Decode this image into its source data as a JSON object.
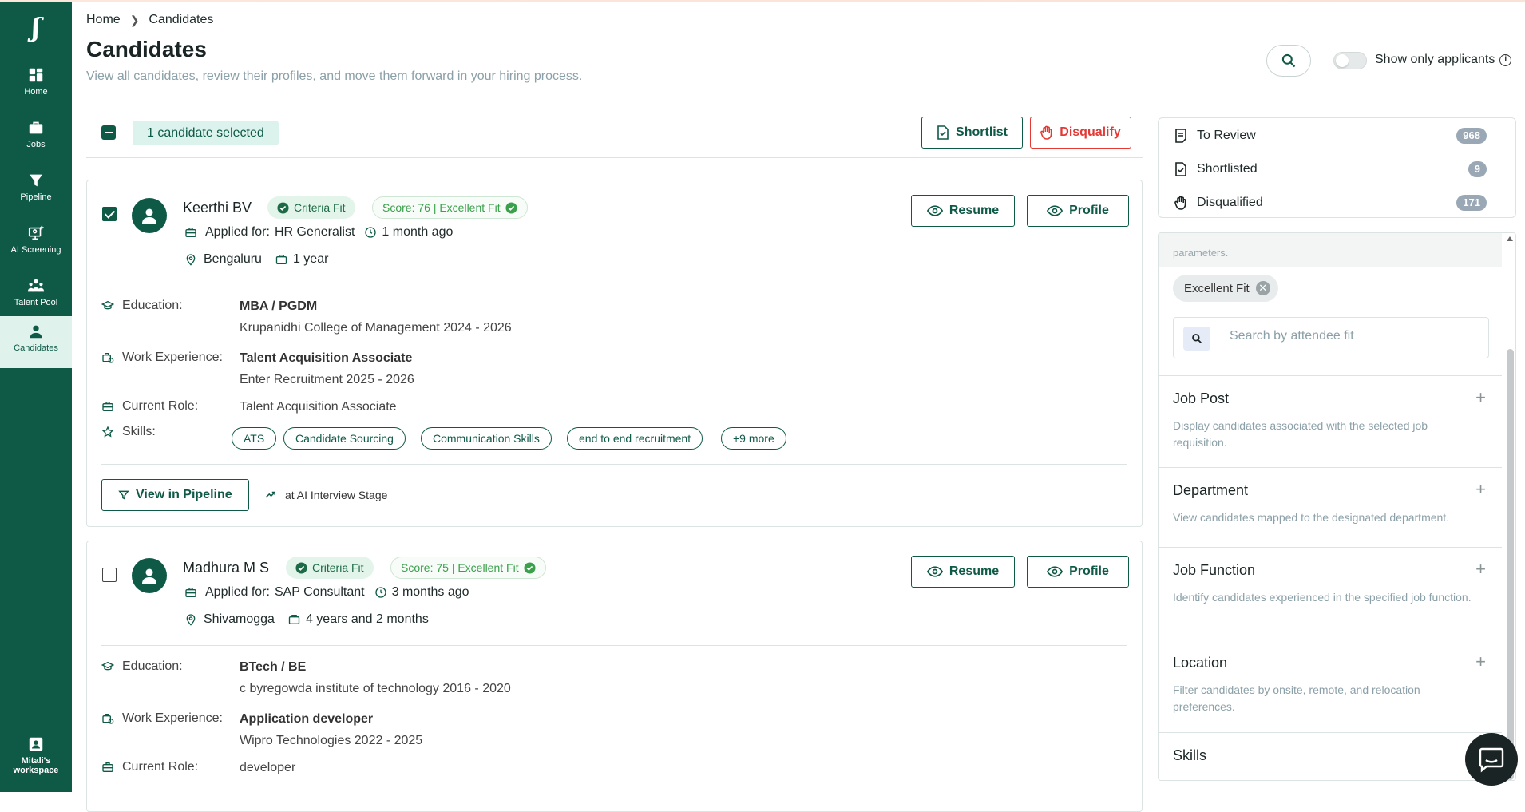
{
  "sidebar": {
    "logo": "ʃ",
    "items": [
      {
        "label": "Home"
      },
      {
        "label": "Jobs"
      },
      {
        "label": "Pipeline"
      },
      {
        "label": "AI Screening"
      },
      {
        "label": "Talent Pool"
      },
      {
        "label": "Candidates"
      }
    ],
    "workspace_line1": "Mitali's",
    "workspace_line2": "workspace"
  },
  "breadcrumb": {
    "home": "Home",
    "current": "Candidates"
  },
  "page": {
    "title": "Candidates",
    "subtitle": "View all candidates, review their profiles, and move them forward in your hiring process.",
    "show_only_label": "Show only applicants",
    "show_only_enabled": false
  },
  "selection": {
    "label": "1 candidate selected",
    "shortlist": "Shortlist",
    "disqualify": "Disqualify"
  },
  "labels": {
    "applied_for": "Applied for:",
    "education": "Education:",
    "work_experience": "Work Experience:",
    "current_role": "Current Role:",
    "skills": "Skills:",
    "resume": "Resume",
    "profile": "Profile",
    "view_in_pipeline": "View in Pipeline"
  },
  "candidates": [
    {
      "name": "Keerthi BV",
      "selected": true,
      "criteria": "Criteria Fit",
      "score": "Score: 76 | Excellent Fit",
      "job": "HR Generalist",
      "time": "1 month ago",
      "location": "Bengaluru",
      "experience": "1 year",
      "education_degree": "MBA / PGDM",
      "education_school": "Krupanidhi College of Management 2024 - 2026",
      "work_title": "Talent Acquisition Associate",
      "work_company": "Enter Recruitment 2025 - 2026",
      "current_role": "Talent Acquisition Associate",
      "skills": [
        "ATS",
        "Candidate Sourcing",
        "Communication Skills",
        "end to end recruitment",
        "+9 more"
      ],
      "stage": "at AI Interview Stage"
    },
    {
      "name": "Madhura M S",
      "selected": false,
      "criteria": "Criteria Fit",
      "score": "Score: 75 | Excellent Fit",
      "job": "SAP Consultant",
      "time": "3 months ago",
      "location": "Shivamogga",
      "experience": "4 years and 2 months",
      "education_degree": "BTech / BE",
      "education_school": "c byregowda institute of technology 2016 - 2020",
      "work_title": "Application developer",
      "work_company": "Wipro Technologies 2022 - 2025",
      "current_role": "developer"
    }
  ],
  "status_counts": [
    {
      "label": "To Review",
      "count": "968"
    },
    {
      "label": "Shortlisted",
      "count": "9"
    },
    {
      "label": "Disqualified",
      "count": "171"
    }
  ],
  "filters": {
    "partial_text": "parameters.",
    "active_chip": "Excellent Fit",
    "search_placeholder": "Search by attendee fit",
    "sections": [
      {
        "title": "Job Post",
        "desc": "Display candidates associated with the selected job requisition."
      },
      {
        "title": "Department",
        "desc": "View candidates mapped to the designated department."
      },
      {
        "title": "Job Function",
        "desc": "Identify candidates experienced in the specified job function."
      },
      {
        "title": "Location",
        "desc": "Filter candidates by onsite, remote, and relocation preferences."
      },
      {
        "title": "Skills",
        "desc": ""
      }
    ]
  },
  "colors": {
    "brand": "#0f5a47",
    "danger": "#e53935",
    "score_green": "#3aa04b"
  }
}
